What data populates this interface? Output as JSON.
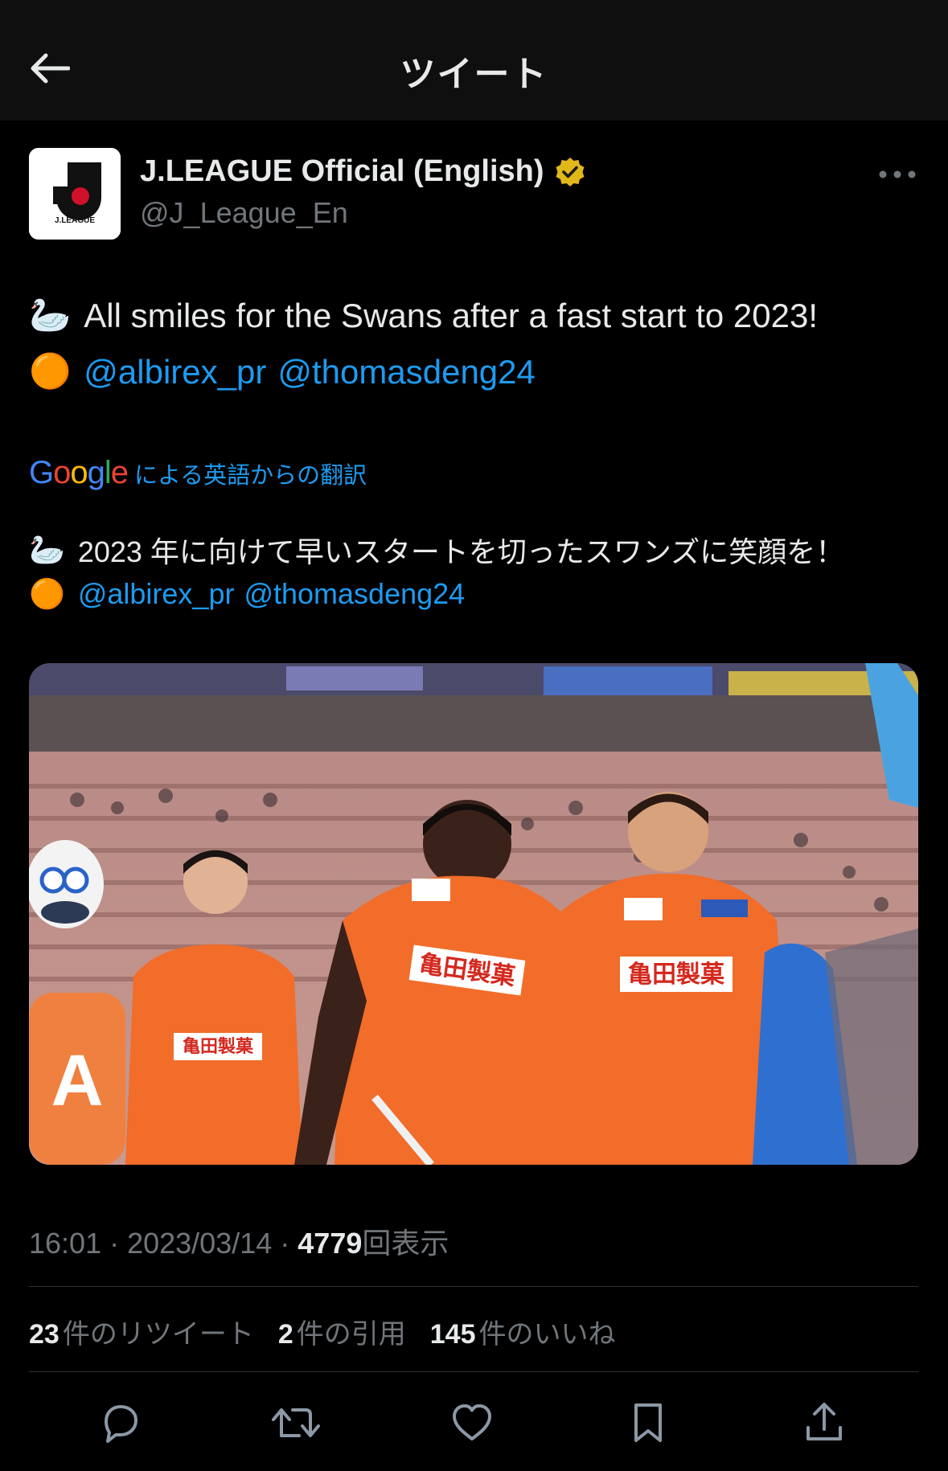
{
  "header": {
    "title": "ツイート"
  },
  "author": {
    "name": "J.LEAGUE Official (English)",
    "handle": "@J_League_En",
    "logo_text": "J.LEAGUE"
  },
  "tweet": {
    "line1_emoji": "🦢",
    "line1_text": "All smiles for the Swans after a fast start to 2023!",
    "line2_emoji": "🟠",
    "mention1": "@albirex_pr",
    "mention2": "@thomasdeng24"
  },
  "translation": {
    "google_logo": [
      "G",
      "o",
      "o",
      "g",
      "l",
      "e"
    ],
    "link_label": "による英語からの翻訳",
    "line1_emoji": "🦢",
    "line1_text": "2023 年に向けて早いスタートを切ったスワンズに笑顔を！",
    "line2_emoji": "🟠",
    "mention1": "@albirex_pr",
    "mention2": "@thomasdeng24"
  },
  "meta": {
    "time": "16:01",
    "sep1": " · ",
    "date": "2023/03/14",
    "sep2": " · ",
    "views_count": "4779",
    "views_label": "回表示"
  },
  "stats": {
    "retweets_count": "23",
    "retweets_label": "件のリツイート",
    "quotes_count": "2",
    "quotes_label": "件の引用",
    "likes_count": "145",
    "likes_label": "件のいいね"
  },
  "colors": {
    "background": "#000000",
    "header_bg": "#0f0f0f",
    "text": "#e7e9ea",
    "muted": "#71767b",
    "link": "#1d9bf0",
    "verified": "#e2b719",
    "jersey_orange": "#f26c2a"
  },
  "icons": [
    "back-arrow-icon",
    "verified-badge-icon",
    "more-icon",
    "reply-icon",
    "retweet-icon",
    "like-icon",
    "bookmark-icon",
    "share-icon"
  ]
}
